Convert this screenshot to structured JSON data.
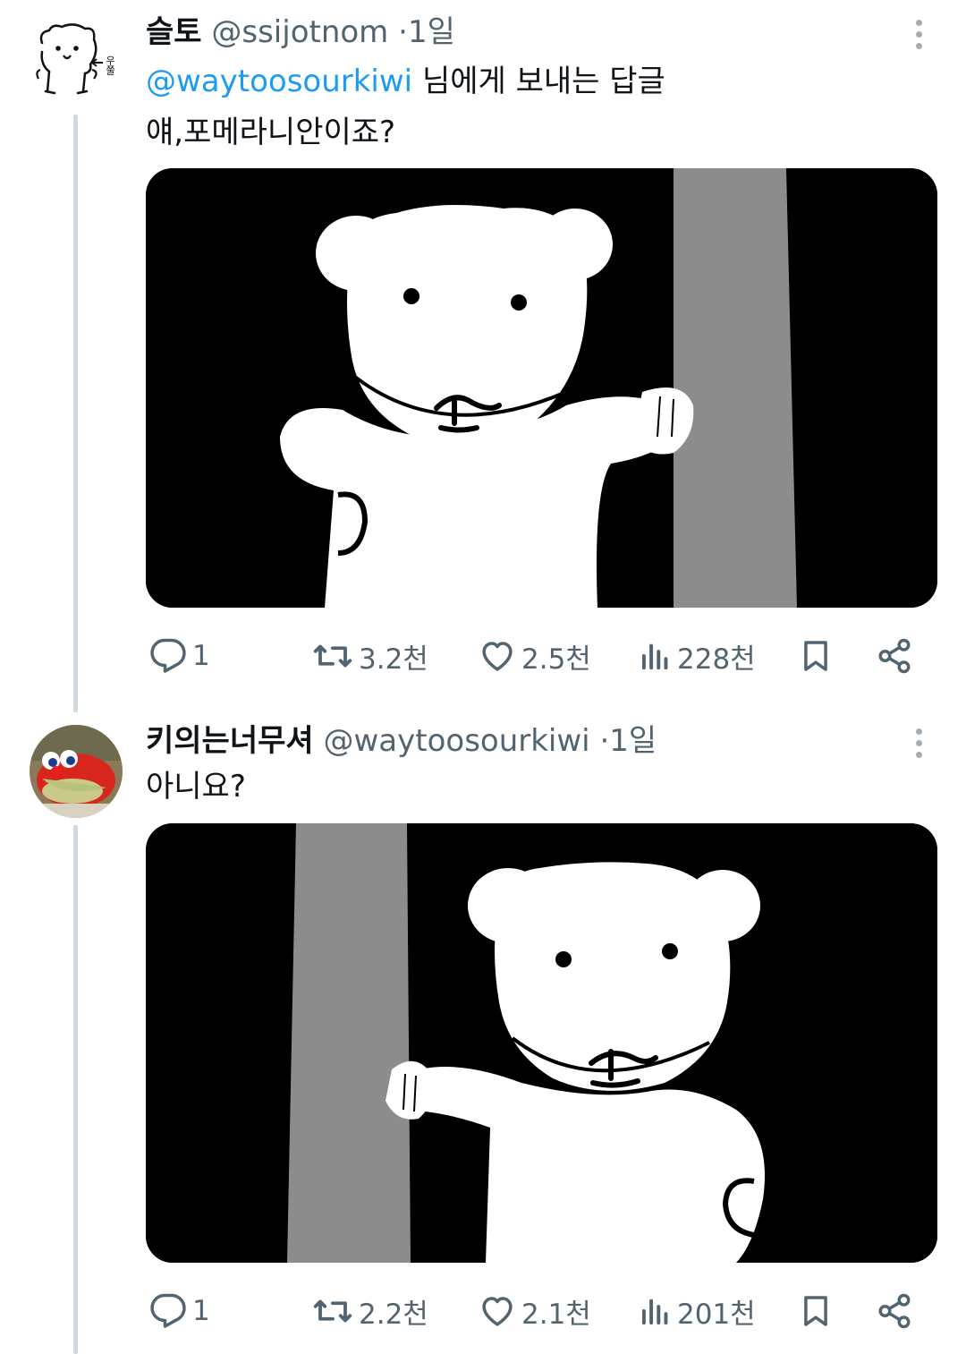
{
  "tweets": [
    {
      "name": "슬토",
      "handle": "@ssijotnom",
      "dot": "·",
      "time": "1일",
      "avatar_text": "우쭐",
      "reply_to": {
        "mention": "@waytoosourkiwi",
        "suffix": " 님에게 보내는 답글"
      },
      "text": "얘,포메라니안이죠?",
      "stats": {
        "replies": "1",
        "retweets": "3.2천",
        "likes": "2.5천",
        "views": "228천"
      }
    },
    {
      "name": "키의는너무셔",
      "handle": "@waytoosourkiwi",
      "dot": "·",
      "time": "1일",
      "text": "아니요?",
      "stats": {
        "replies": "1",
        "retweets": "2.2천",
        "likes": "2.1천",
        "views": "201천"
      }
    }
  ],
  "icons": {
    "reply": "reply-icon",
    "retweet": "retweet-icon",
    "like": "heart-icon",
    "views": "views-icon",
    "bookmark": "bookmark-icon",
    "share": "share-icon",
    "more": "more-icon"
  },
  "colors": {
    "text": "#0f1419",
    "secondary": "#536471",
    "mention": "#1d9bf0",
    "thread_line": "#cfd9de"
  }
}
